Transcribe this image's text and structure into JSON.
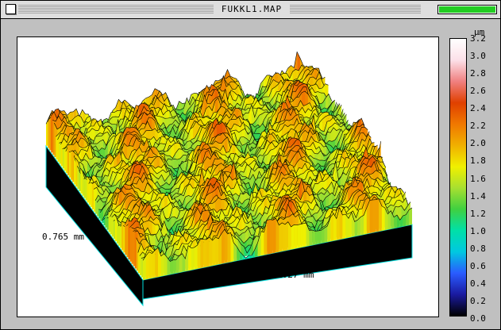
{
  "window": {
    "title": "FUKKL1.MAP",
    "progress_fraction": 1.0
  },
  "plot": {
    "x_axis_label": "1.27 mm",
    "y_axis_label": "0.765 mm"
  },
  "colorbar": {
    "unit": "µm",
    "ticks": [
      "3.2",
      "3.0",
      "2.8",
      "2.6",
      "2.4",
      "2.2",
      "2.0",
      "1.8",
      "1.6",
      "1.4",
      "1.2",
      "1.0",
      "0.8",
      "0.6",
      "0.4",
      "0.2",
      "0.0"
    ],
    "colors": [
      "#000000",
      "#1a1aa0",
      "#2a5cff",
      "#00c8e0",
      "#00e0a8",
      "#40d040",
      "#a8e030",
      "#f0f000",
      "#f0b000",
      "#f07800",
      "#e04000",
      "#f08080",
      "#fce0e8",
      "#ffffff"
    ]
  },
  "colors": {
    "progress": "#22cc22",
    "base": "#000000",
    "edge": "#00e0e0"
  }
}
